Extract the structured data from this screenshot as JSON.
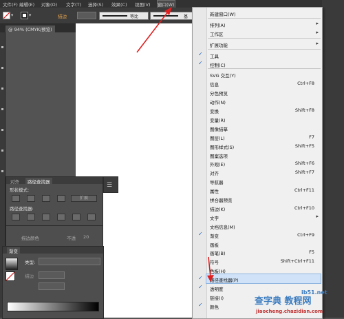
{
  "menubar": {
    "items": [
      {
        "label": "文件(F)"
      },
      {
        "label": "编辑(E)"
      },
      {
        "label": "对象(O)"
      },
      {
        "label": "文字(T)"
      },
      {
        "label": "选择(S)"
      },
      {
        "label": "效果(C)"
      },
      {
        "label": "视图(V)"
      },
      {
        "label": "窗口(W)"
      }
    ]
  },
  "controlbar": {
    "stroke_label": "描边",
    "stroke_profile": "等比",
    "brush": "基"
  },
  "document_tab": {
    "label": "@ 94% (CMYK/预览)"
  },
  "pathfinder_panel": {
    "tabs": [
      "对齐",
      "路径查找器"
    ],
    "shape_modes_label": "形状模式:",
    "expand_label": "扩展",
    "pathfinders_label": "路径查找器:",
    "stroke_color_label": "描边颜色",
    "opacity_label": "不透",
    "opacity_value": "20"
  },
  "gradient_panel": {
    "tab": "渐变",
    "type_label": "类型:",
    "stroke_label": "描边",
    "angle_label": "位置"
  },
  "window_menu": {
    "items": [
      {
        "label": "新建窗口(W)",
        "shortcut": "",
        "checked": false,
        "submenu": false
      },
      {
        "label": "排列(A)",
        "shortcut": "",
        "checked": false,
        "submenu": true
      },
      {
        "label": "工作区",
        "shortcut": "",
        "checked": false,
        "submenu": true
      },
      {
        "label": "扩展功能",
        "shortcut": "",
        "checked": false,
        "submenu": true
      },
      {
        "label": "工具",
        "shortcut": "",
        "checked": true,
        "submenu": false
      },
      {
        "label": "控制(C)",
        "shortcut": "",
        "checked": true,
        "submenu": false
      },
      {
        "label": "SVG 交互(Y)",
        "shortcut": "",
        "checked": false,
        "submenu": false
      },
      {
        "label": "信息",
        "shortcut": "Ctrl+F8",
        "checked": false,
        "submenu": false
      },
      {
        "label": "分色预览",
        "shortcut": "",
        "checked": false,
        "submenu": false
      },
      {
        "label": "动作(N)",
        "shortcut": "",
        "checked": false,
        "submenu": false
      },
      {
        "label": "变换",
        "shortcut": "Shift+F8",
        "checked": false,
        "submenu": false
      },
      {
        "label": "变量(R)",
        "shortcut": "",
        "checked": false,
        "submenu": false
      },
      {
        "label": "图像描摹",
        "shortcut": "",
        "checked": false,
        "submenu": false
      },
      {
        "label": "图层(L)",
        "shortcut": "F7",
        "checked": false,
        "submenu": false
      },
      {
        "label": "图形样式(S)",
        "shortcut": "Shift+F5",
        "checked": false,
        "submenu": false
      },
      {
        "label": "图案选项",
        "shortcut": "",
        "checked": false,
        "submenu": false
      },
      {
        "label": "外观(E)",
        "shortcut": "Shift+F6",
        "checked": false,
        "submenu": false
      },
      {
        "label": "对齐",
        "shortcut": "Shift+F7",
        "checked": false,
        "submenu": false
      },
      {
        "label": "导航器",
        "shortcut": "",
        "checked": false,
        "submenu": false
      },
      {
        "label": "属性",
        "shortcut": "Ctrl+F11",
        "checked": false,
        "submenu": false
      },
      {
        "label": "拼合器预览",
        "shortcut": "",
        "checked": false,
        "submenu": false
      },
      {
        "label": "描边(K)",
        "shortcut": "Ctrl+F10",
        "checked": false,
        "submenu": false
      },
      {
        "label": "文字",
        "shortcut": "",
        "checked": false,
        "submenu": true
      },
      {
        "label": "文档信息(M)",
        "shortcut": "",
        "checked": false,
        "submenu": false
      },
      {
        "label": "渐变",
        "shortcut": "Ctrl+F9",
        "checked": true,
        "submenu": false
      },
      {
        "label": "画板",
        "shortcut": "",
        "checked": false,
        "submenu": false
      },
      {
        "label": "画笔(B)",
        "shortcut": "F5",
        "checked": false,
        "submenu": false
      },
      {
        "label": "符号",
        "shortcut": "Shift+Ctrl+F11",
        "checked": false,
        "submenu": false
      },
      {
        "label": "色板(H)",
        "shortcut": "",
        "checked": false,
        "submenu": false
      },
      {
        "label": "路径查找器(P)",
        "shortcut": "",
        "checked": true,
        "submenu": false
      },
      {
        "label": "透明度",
        "shortcut": "",
        "checked": true,
        "submenu": false
      },
      {
        "label": "链接(I)",
        "shortcut": "",
        "checked": false,
        "submenu": false
      },
      {
        "label": "颜色",
        "shortcut": "",
        "checked": true,
        "submenu": false
      }
    ]
  },
  "watermark": {
    "line1": "查字典 教程网",
    "site": "ib51.net",
    "url": "jiaocheng.chazidian.com"
  },
  "colors": {
    "arrow": "#e02020",
    "menu_highlight": "#cfe2f7",
    "check": "#2a67c4"
  }
}
